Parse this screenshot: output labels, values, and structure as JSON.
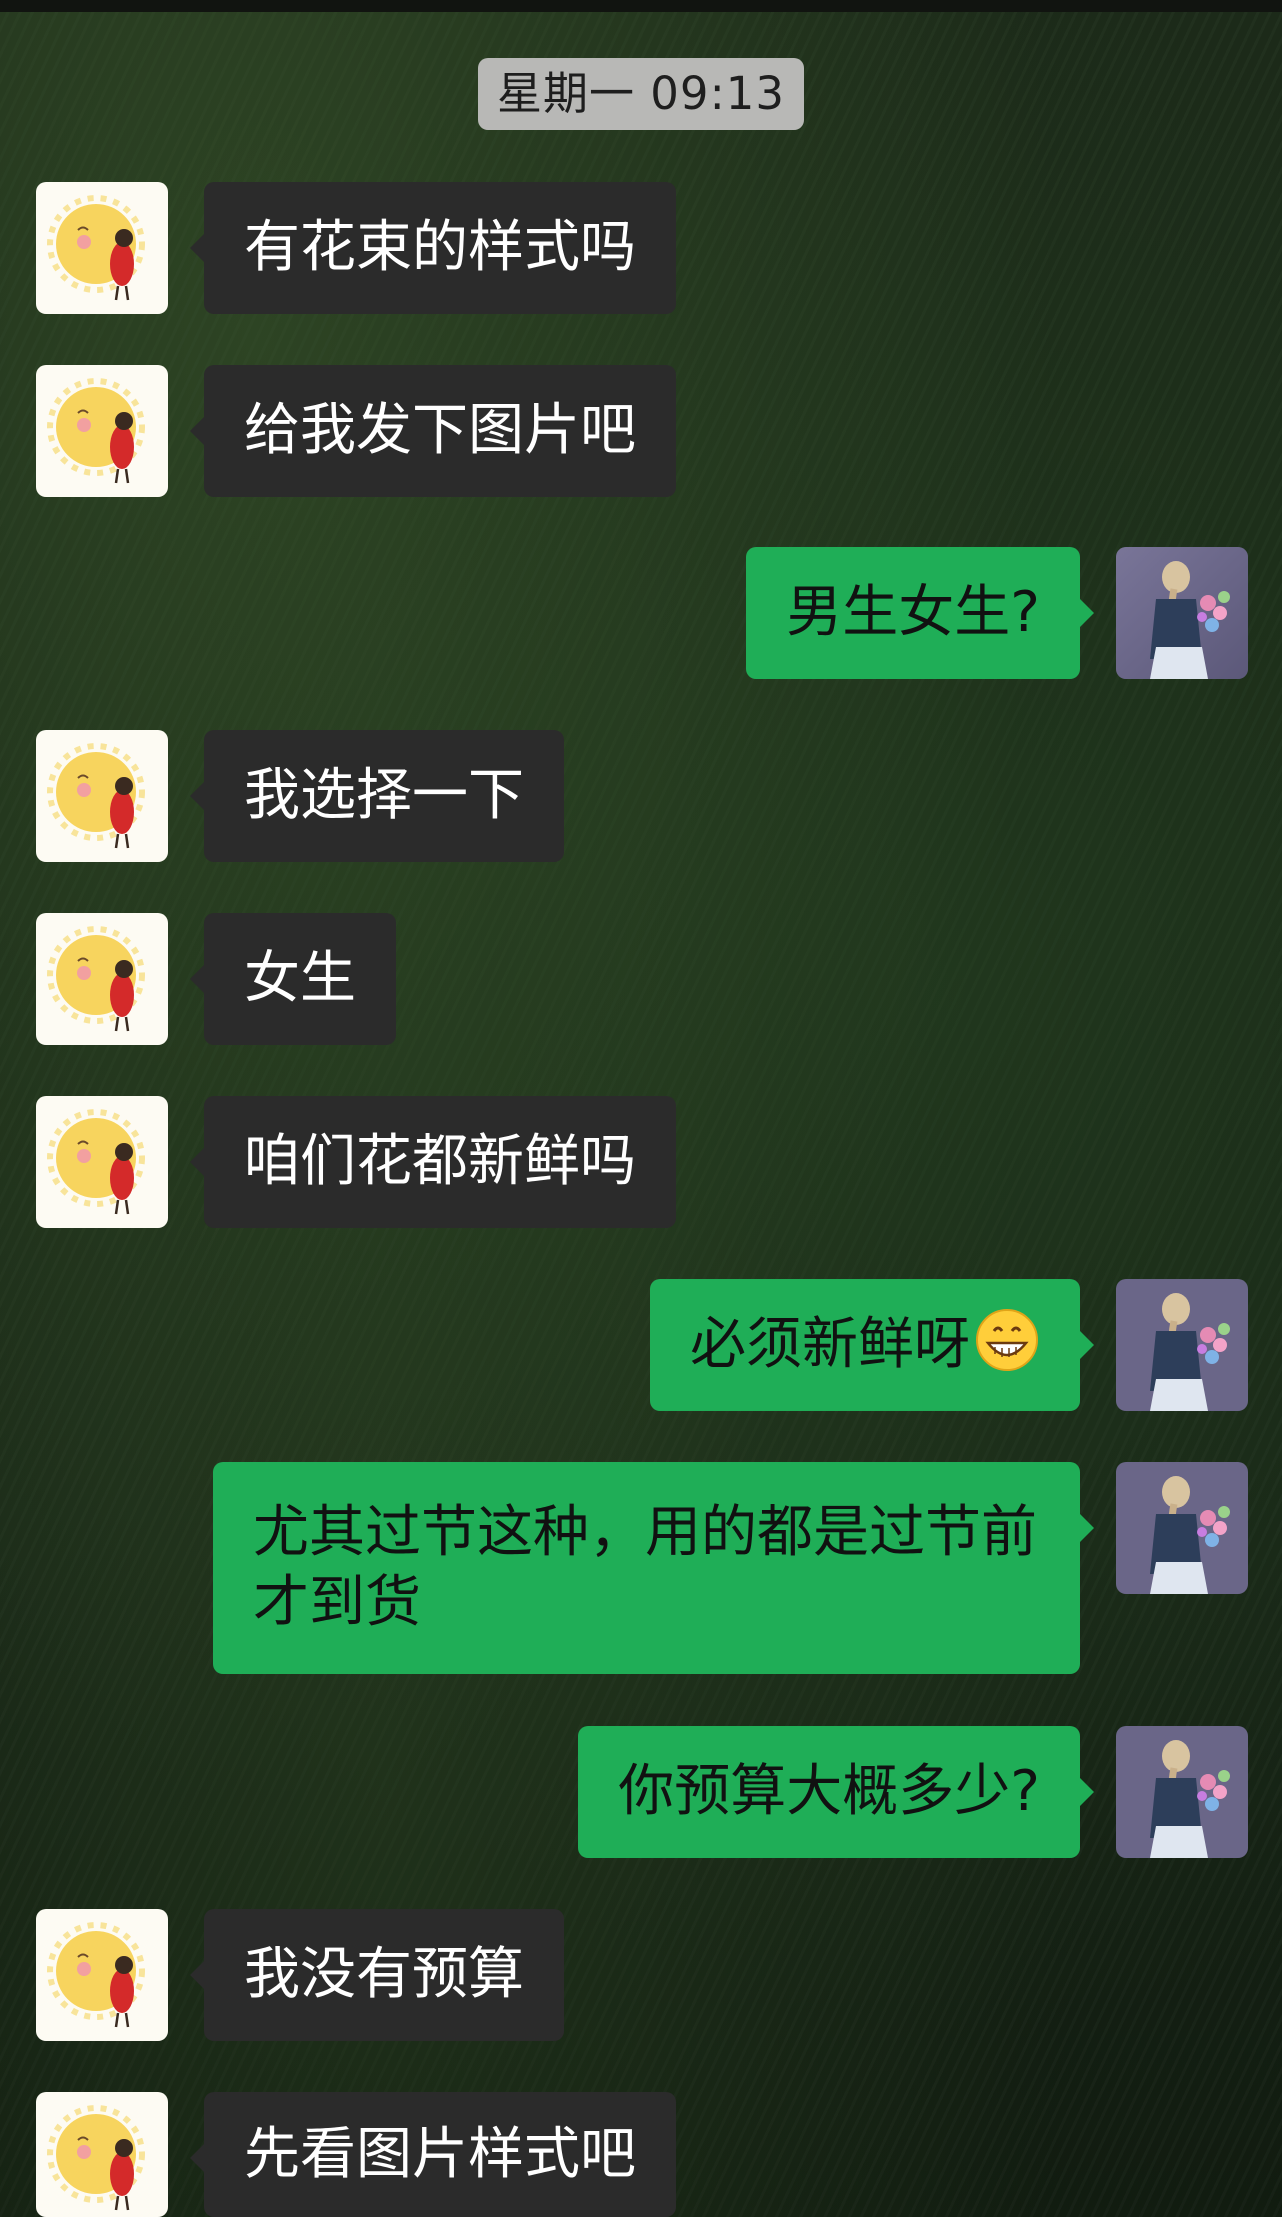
{
  "chat": {
    "timestamp": "星期一 09:13",
    "messages": [
      {
        "side": "left",
        "text": "有花束的样式吗"
      },
      {
        "side": "left",
        "text": "给我发下图片吧"
      },
      {
        "side": "right",
        "text": "男生女生?"
      },
      {
        "side": "left",
        "text": "我选择一下"
      },
      {
        "side": "left",
        "text": "女生"
      },
      {
        "side": "left",
        "text": "咱们花都新鲜吗"
      },
      {
        "side": "right",
        "text": "必须新鲜呀",
        "emoji": "grinning-face-emoji"
      },
      {
        "side": "right",
        "text": "尤其过节这种，用的都是过节前才到货"
      },
      {
        "side": "right",
        "text": "你预算大概多少?"
      },
      {
        "side": "left",
        "text": "我没有预算"
      },
      {
        "side": "left",
        "text": "先看图片样式吧"
      }
    ]
  },
  "avatars": {
    "contact": "sun-girl-avatar-icon",
    "self": "girl-with-flowers-avatar-icon"
  },
  "colors": {
    "outgoing_bubble": "#1fae57",
    "incoming_bubble": "#2b2b2b",
    "timestamp_chip": "#b8b8b6",
    "background": "#1a2a18"
  }
}
